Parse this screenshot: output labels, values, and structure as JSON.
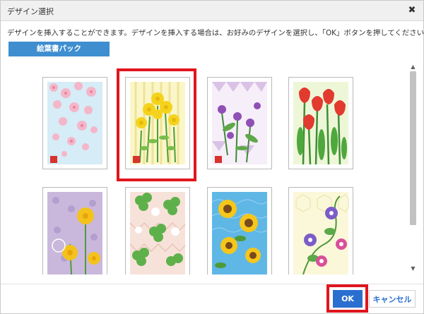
{
  "dialog": {
    "title": "デザイン選択",
    "close_icon": "close-icon",
    "description": "デザインを挿入することができます。デザインを挿入する場合は、お好みのデザインを選択し、「OK」ボタンを押してください。",
    "pack_button": "絵葉書パック"
  },
  "designs": [
    {
      "name": "sakura",
      "selected": false
    },
    {
      "name": "nanohana",
      "selected": true
    },
    {
      "name": "sumire",
      "selected": false
    },
    {
      "name": "tulip",
      "selected": false
    },
    {
      "name": "tanpopo",
      "selected": false
    },
    {
      "name": "clover",
      "selected": false
    },
    {
      "name": "himawari",
      "selected": false
    },
    {
      "name": "asagao",
      "selected": false
    }
  ],
  "footer": {
    "ok_label": "OK",
    "cancel_label": "キャンセル"
  },
  "colors": {
    "accent": "#2a6fcf",
    "pack_button": "#3e8ed0",
    "highlight": "#e0151d"
  }
}
